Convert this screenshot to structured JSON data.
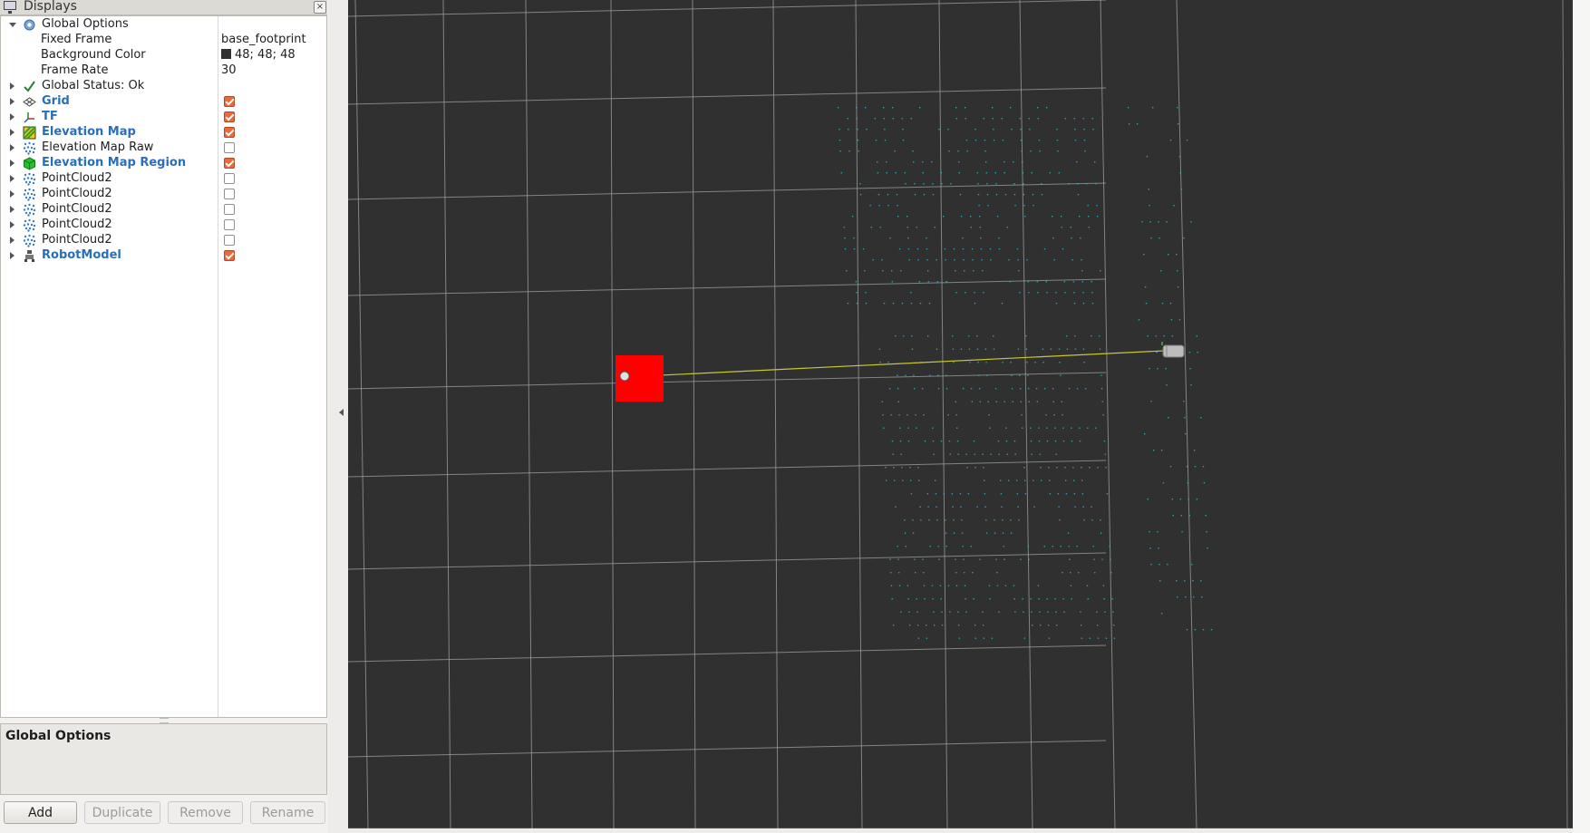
{
  "panel": {
    "title": "Displays",
    "close_glyph": "×"
  },
  "tree": {
    "global_options": {
      "label": "Global Options",
      "fixed_frame_label": "Fixed Frame",
      "fixed_frame_value": "base_footprint",
      "bg_color_label": "Background Color",
      "bg_color_value": "48; 48; 48",
      "bg_color_hex": "#303030",
      "frame_rate_label": "Frame Rate",
      "frame_rate_value": "30"
    },
    "status": {
      "label": "Global Status: Ok",
      "icon": "check-icon"
    },
    "displays": [
      {
        "label": "Grid",
        "icon": "grid-icon",
        "enabled": true,
        "highlight": true
      },
      {
        "label": "TF",
        "icon": "tf-icon",
        "enabled": true,
        "highlight": true
      },
      {
        "label": "Elevation Map",
        "icon": "elevation-map-icon",
        "enabled": true,
        "highlight": true
      },
      {
        "label": "Elevation Map Raw",
        "icon": "pointcloud-icon",
        "enabled": false,
        "highlight": false
      },
      {
        "label": "Elevation Map Region",
        "icon": "marker-cube-icon",
        "enabled": true,
        "highlight": true
      },
      {
        "label": "PointCloud2",
        "icon": "pointcloud-icon",
        "enabled": false,
        "highlight": false
      },
      {
        "label": "PointCloud2",
        "icon": "pointcloud-icon",
        "enabled": false,
        "highlight": false
      },
      {
        "label": "PointCloud2",
        "icon": "pointcloud-icon",
        "enabled": false,
        "highlight": false
      },
      {
        "label": "PointCloud2",
        "icon": "pointcloud-icon",
        "enabled": false,
        "highlight": false
      },
      {
        "label": "PointCloud2",
        "icon": "pointcloud-icon",
        "enabled": false,
        "highlight": false
      },
      {
        "label": "RobotModel",
        "icon": "robot-model-icon",
        "enabled": true,
        "highlight": true
      }
    ]
  },
  "description": {
    "title": "Global Options"
  },
  "buttons": {
    "add": "Add",
    "duplicate": "Duplicate",
    "remove": "Remove",
    "rename": "Rename"
  },
  "colors": {
    "viewport_bg": "#303030",
    "grid_line": "#a0a0a0",
    "checkbox_on": "#e9693f",
    "display_name": "#2a6ebb",
    "robot_box": "#ff0000",
    "tf_link": "#c8c832",
    "points": "#3ab6c8"
  }
}
